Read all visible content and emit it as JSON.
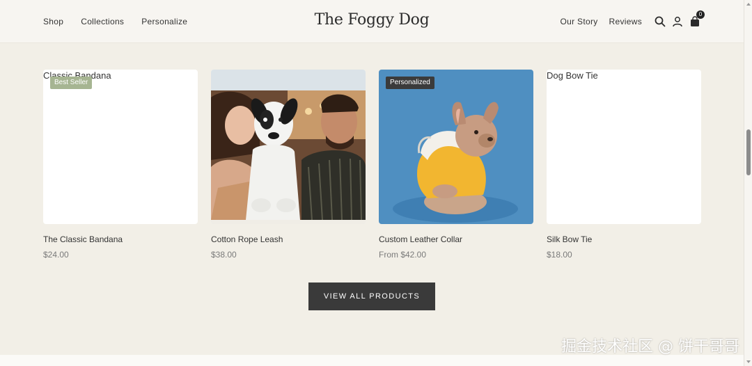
{
  "header": {
    "nav_left": [
      "Shop",
      "Collections",
      "Personalize"
    ],
    "logo": "The Foggy Dog",
    "nav_right": [
      "Our Story",
      "Reviews"
    ],
    "cart_count": "0",
    "icons": [
      "search-icon",
      "account-icon",
      "cart-icon"
    ]
  },
  "products": [
    {
      "name": "The Classic Bandana",
      "price": "$24.00",
      "badge": "Best Seller",
      "image_alt": "Classic Bandana"
    },
    {
      "name": "Cotton Rope Leash",
      "price": "$38.00",
      "badge": "",
      "image_alt": ""
    },
    {
      "name": "Custom Leather Collar",
      "price": "From $42.00",
      "badge": "Personalized",
      "image_alt": ""
    },
    {
      "name": "Silk Bow Tie",
      "price": "$18.00",
      "badge": "",
      "image_alt": "Dog Bow Tie"
    }
  ],
  "cta": {
    "view_all": "VIEW ALL PRODUCTS"
  },
  "watermark": "掘金技术社区 @ 饼干哥哥",
  "colors": {
    "background": "#f2efe7",
    "button": "#3a3a3a",
    "badge_green": "#a6b592",
    "badge_dark": "#3b3b3b"
  }
}
